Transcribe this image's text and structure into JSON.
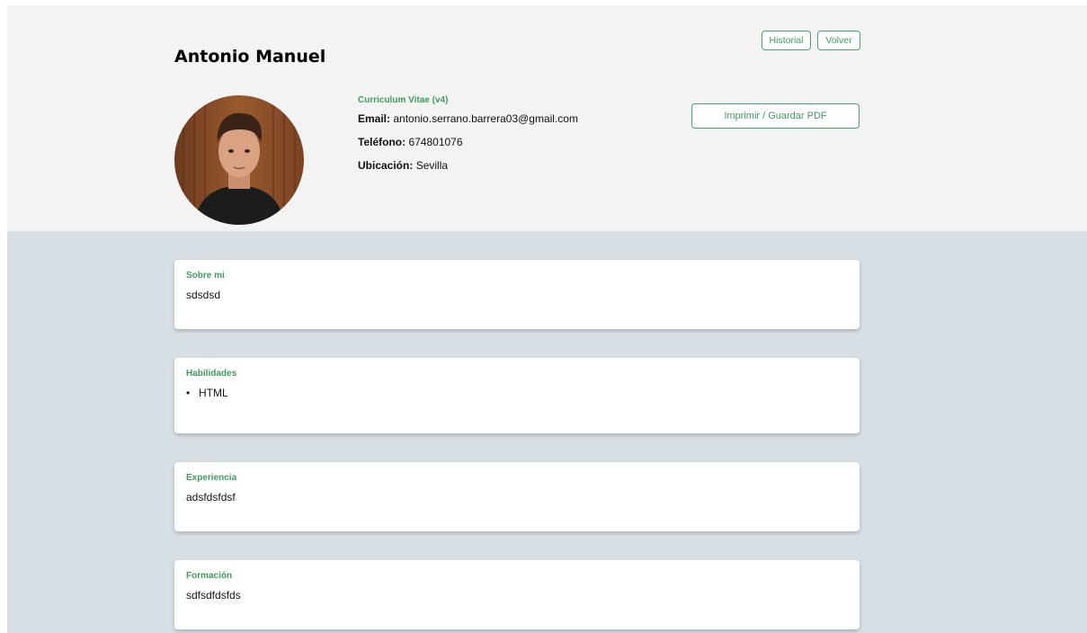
{
  "profile": {
    "name": "Antonio Manuel",
    "cv_title": "Curriculum Vitae (v4)",
    "email_label": "Email:",
    "email": "antonio.serrano.barrera03@gmail.com",
    "phone_label": "Teléfono:",
    "phone": "674801076",
    "location_label": "Ubicación:",
    "location": "Sevilla"
  },
  "buttons": {
    "historial": "Historial",
    "volver": "Volver",
    "print": "Imprimir / Guardar PDF"
  },
  "sections": {
    "about": {
      "title": "Sobre mi",
      "text": "sdsdsd"
    },
    "skills": {
      "title": "Habilidades",
      "items": [
        "HTML"
      ]
    },
    "experience": {
      "title": "Experiencia",
      "text": "adsfdsfdsf"
    },
    "education": {
      "title": "Formación",
      "text": "sdfsdfdsfds"
    }
  },
  "colors": {
    "accent": "#3f9a5f",
    "header_bg": "#f3f3f3",
    "main_bg": "#d8dfe4"
  }
}
